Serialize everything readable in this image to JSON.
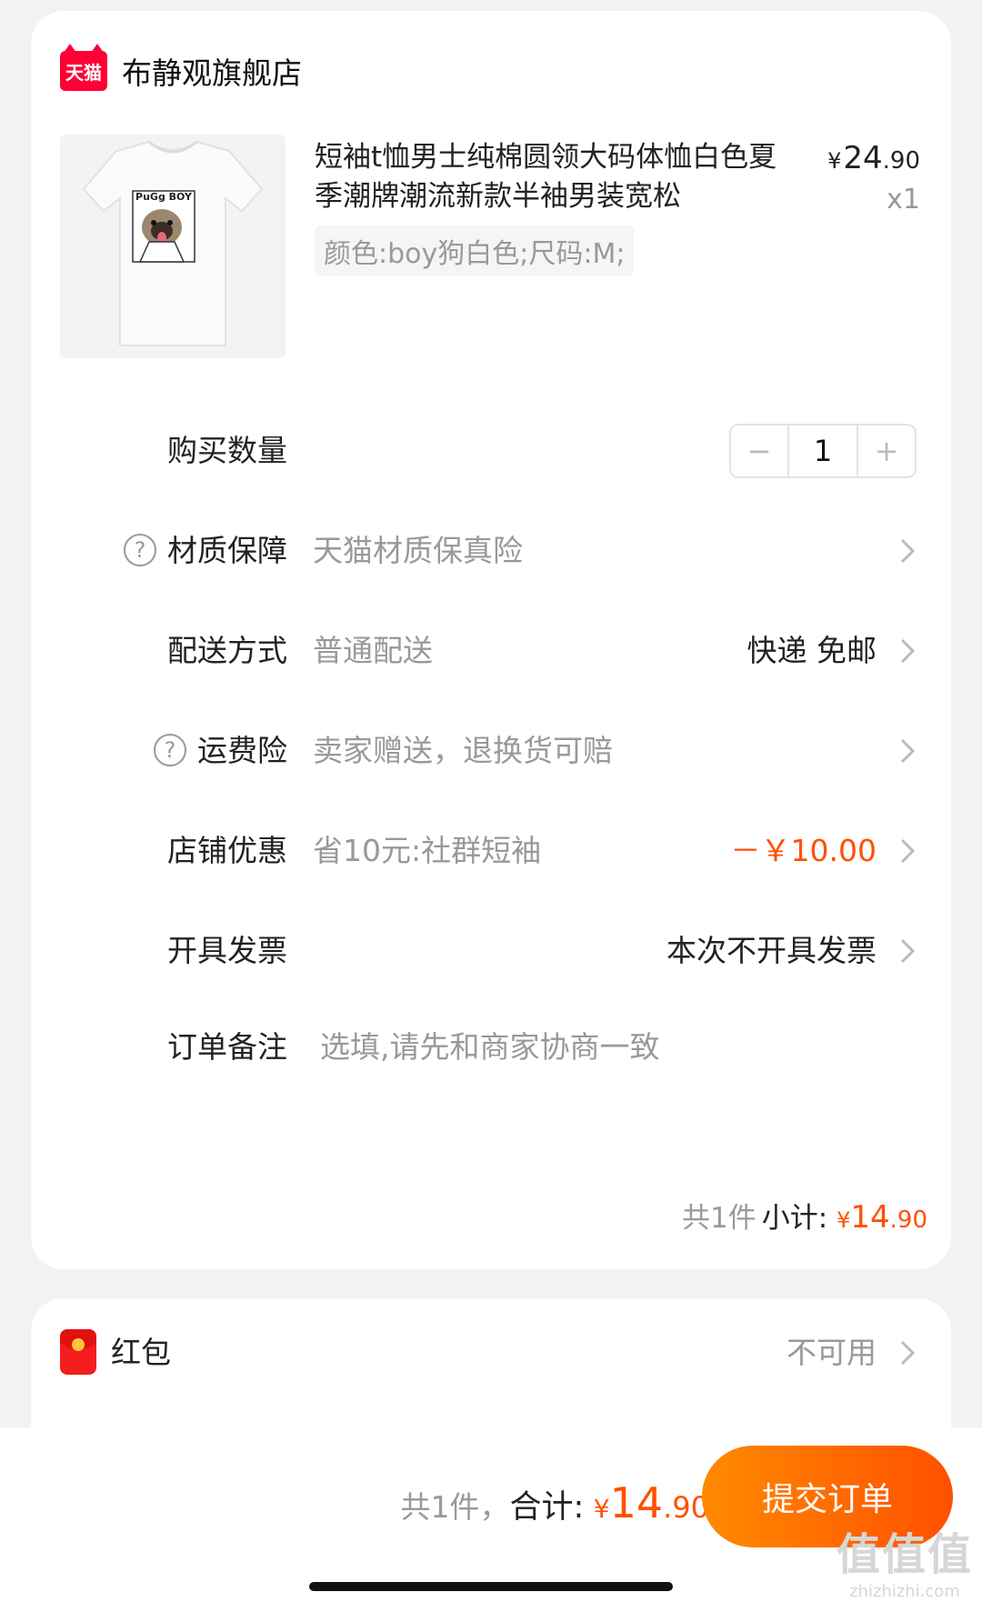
{
  "store": {
    "logo_text": "天猫",
    "name": "布静观旗舰店"
  },
  "product": {
    "title": "短袖t恤男士纯棉圆领大码体恤白色夏季潮牌潮流新款半袖男装宽松",
    "price_currency": "¥",
    "price_int": "24",
    "price_dec": ".90",
    "quantity_label": "x1",
    "sku": "颜色:boy狗白色;尺码:M;",
    "image_print_text": "PuGg BOY"
  },
  "rows": {
    "quantity": {
      "label": "购买数量",
      "value": "1",
      "minus": "−",
      "plus": "+"
    },
    "material": {
      "label": "材质保障",
      "value": "天猫材质保真险"
    },
    "delivery": {
      "label": "配送方式",
      "value": "普通配送",
      "right": "快递 免邮"
    },
    "shipping_insurance": {
      "label": "运费险",
      "value": "卖家赠送，退换货可赔"
    },
    "store_discount": {
      "label": "店铺优惠",
      "value": "省10元:社群短袖",
      "right": "－￥10.00"
    },
    "invoice": {
      "label": "开具发票",
      "right": "本次不开具发票"
    },
    "note": {
      "label": "订单备注",
      "placeholder": "选填,请先和商家协商一致"
    }
  },
  "subtotal": {
    "count": "共1件",
    "label": "小计:",
    "currency": "¥",
    "int": "14",
    "dec": ".90"
  },
  "red_packet": {
    "label": "红包",
    "status": "不可用"
  },
  "footer": {
    "count": "共1件，",
    "label": "合计:",
    "currency": "¥",
    "int": "14",
    "dec": ".90",
    "submit": "提交订单"
  },
  "watermark": {
    "big": "值值值",
    "small": "zhizhizhi.com"
  },
  "colors": {
    "accent": "#ff5000",
    "tmall_red": "#ff0036"
  }
}
